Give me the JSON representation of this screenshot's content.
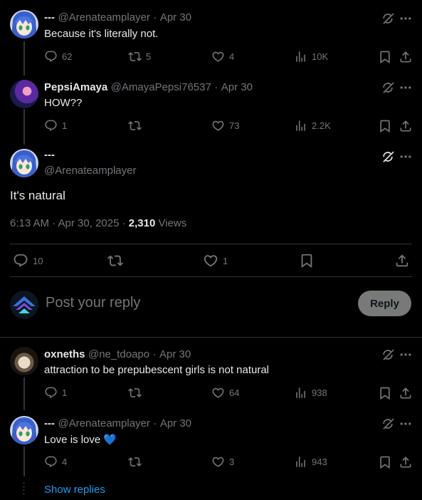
{
  "posts": [
    {
      "name": "---",
      "handle": "@Arenateamplayer",
      "time": "Apr 30",
      "text": "Because it's literally not.",
      "stats": {
        "reply": "62",
        "repost": "5",
        "like": "4",
        "views": "10K"
      }
    },
    {
      "name": "PepsiAmaya",
      "handle": "@AmayaPepsi76537",
      "time": "Apr 30",
      "text": "HOW??",
      "stats": {
        "reply": "1",
        "repost": "",
        "like": "73",
        "views": "2.2K"
      }
    }
  ],
  "main": {
    "name": "---",
    "handle": "@Arenateamplayer",
    "text": "It's natural",
    "timestamp": "6:13 AM · Apr 30, 2025 · ",
    "views_count": "2,310",
    "views_label": " Views",
    "stats": {
      "reply": "10",
      "repost": "",
      "like": "1"
    }
  },
  "composer": {
    "placeholder": "Post your reply",
    "button": "Reply"
  },
  "replies": [
    {
      "name": "oxneths",
      "handle": "@ne_tdoapo",
      "time": "Apr 30",
      "text": "attraction to be prepubescent girls is not natural",
      "stats": {
        "reply": "1",
        "repost": "",
        "like": "64",
        "views": "938"
      }
    },
    {
      "name": "---",
      "handle": "@Arenateamplayer",
      "time": "Apr 30",
      "text": "Love is love",
      "emoji": "💙",
      "stats": {
        "reply": "4",
        "repost": "",
        "like": "3",
        "views": "943"
      }
    }
  ],
  "show_replies": "Show replies",
  "dot_sep": "·",
  "colors": {
    "accent": "#1d9bf0",
    "muted": "#71767b",
    "divider": "#2f3336",
    "reply_button": "#787a7a"
  }
}
